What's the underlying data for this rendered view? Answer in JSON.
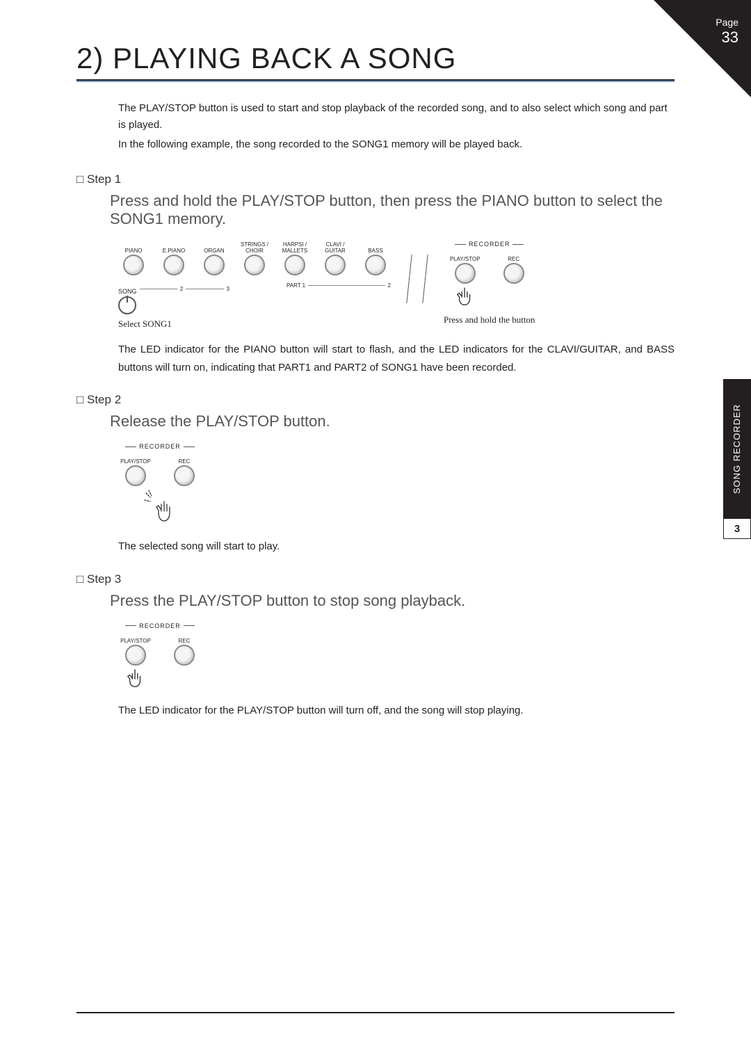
{
  "pageCorner": {
    "label": "Page",
    "number": "33"
  },
  "sideTab": {
    "label": "SONG RECORDER",
    "chapter": "3"
  },
  "title": "2) PLAYING BACK A SONG",
  "intro1": "The PLAY/STOP button is used to start and stop playback of the recorded song, and to also select which song and part is played.",
  "intro2": "In the following example, the song recorded to the SONG1 memory will be played back.",
  "step1": {
    "head": "Step 1",
    "action": "Press and hold the PLAY/STOP button, then press the PIANO button to select the SONG1 memory.",
    "buttons": [
      "PIANO",
      "E.PIANO",
      "ORGAN",
      "STRINGS /\nCHOIR",
      "HARPSI /\nMALLETS",
      "CLAVI /\nGUITAR",
      "BASS"
    ],
    "songLabel": "SONG",
    "songNums": [
      "2",
      "3"
    ],
    "partLabel": "PART 1",
    "partNum": "2",
    "leftCaption": "Select SONG1",
    "recorder": {
      "title": "RECORDER",
      "left": "PLAY/STOP",
      "right": "REC"
    },
    "rightCaption": "Press and hold the button",
    "para": "The LED indicator for the PIANO button will start to flash, and the LED indicators for the CLAVI/GUITAR, and BASS buttons will turn on, indicating that PART1 and PART2 of SONG1 have been recorded."
  },
  "step2": {
    "head": "Step 2",
    "action": "Release the PLAY/STOP button.",
    "recorder": {
      "title": "RECORDER",
      "left": "PLAY/STOP",
      "right": "REC"
    },
    "para": "The selected song will start to play."
  },
  "step3": {
    "head": "Step 3",
    "action": "Press the PLAY/STOP button to stop song playback.",
    "recorder": {
      "title": "RECORDER",
      "left": "PLAY/STOP",
      "right": "REC"
    },
    "para": "The LED indicator for the PLAY/STOP button will turn off, and the song will stop playing."
  }
}
